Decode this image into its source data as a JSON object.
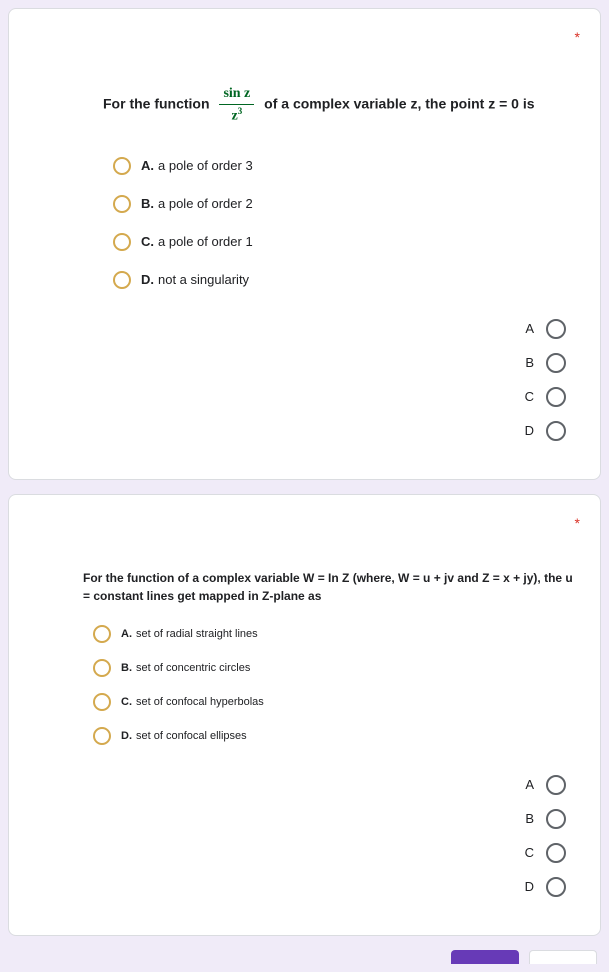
{
  "required_mark": "*",
  "q1": {
    "prefix": "For the function",
    "frac_num": "sin z",
    "frac_den_base": "z",
    "frac_den_exp": "3",
    "suffix": "of a complex variable z, the point z = 0 is",
    "options": [
      {
        "letter": "A.",
        "text": "a pole of order 3"
      },
      {
        "letter": "B.",
        "text": "a pole of order 2"
      },
      {
        "letter": "C.",
        "text": "a pole of order 1"
      },
      {
        "letter": "D.",
        "text": "not a singularity"
      }
    ],
    "answers": [
      "A",
      "B",
      "C",
      "D"
    ]
  },
  "q2": {
    "text": "For the function of a complex variable W = In Z (where, W = u + jv and Z = x + jy), the u = constant lines get mapped in Z-plane as",
    "options": [
      {
        "letter": "A.",
        "text": "set of radial straight lines"
      },
      {
        "letter": "B.",
        "text": "set of concentric circles"
      },
      {
        "letter": "C.",
        "text": "set of confocal hyperbolas"
      },
      {
        "letter": "D.",
        "text": "set of confocal ellipses"
      }
    ],
    "answers": [
      "A",
      "B",
      "C",
      "D"
    ]
  }
}
